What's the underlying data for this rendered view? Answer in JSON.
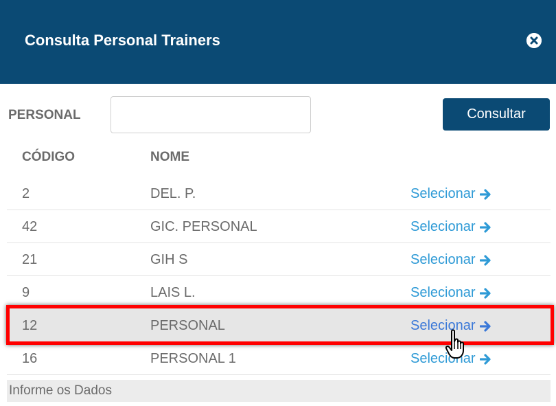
{
  "header": {
    "title": "Consulta Personal Trainers",
    "close_icon": "close-circle-icon",
    "background": "#0b4a74"
  },
  "filter": {
    "label": "PERSONAL",
    "input_value": "",
    "button_label": "Consultar"
  },
  "table": {
    "columns": [
      "CÓDIGO",
      "NOME"
    ],
    "rows": [
      {
        "code": "2",
        "name": "DEL. P.",
        "action": "Selecionar"
      },
      {
        "code": "42",
        "name": "GIC. PERSONAL",
        "action": "Selecionar"
      },
      {
        "code": "21",
        "name": "GIH S",
        "action": "Selecionar"
      },
      {
        "code": "9",
        "name": "LAIS L.",
        "action": "Selecionar"
      },
      {
        "code": "12",
        "name": "PERSONAL",
        "action": "Selecionar"
      },
      {
        "code": "16",
        "name": "PERSONAL 1",
        "action": "Selecionar"
      }
    ],
    "action_icon": "arrow-right-icon",
    "link_color": "#2e9ad6",
    "highlighted_row_index": 4,
    "highlight_color": "#ff0000"
  },
  "footer": {
    "status": "Informe os Dados"
  }
}
